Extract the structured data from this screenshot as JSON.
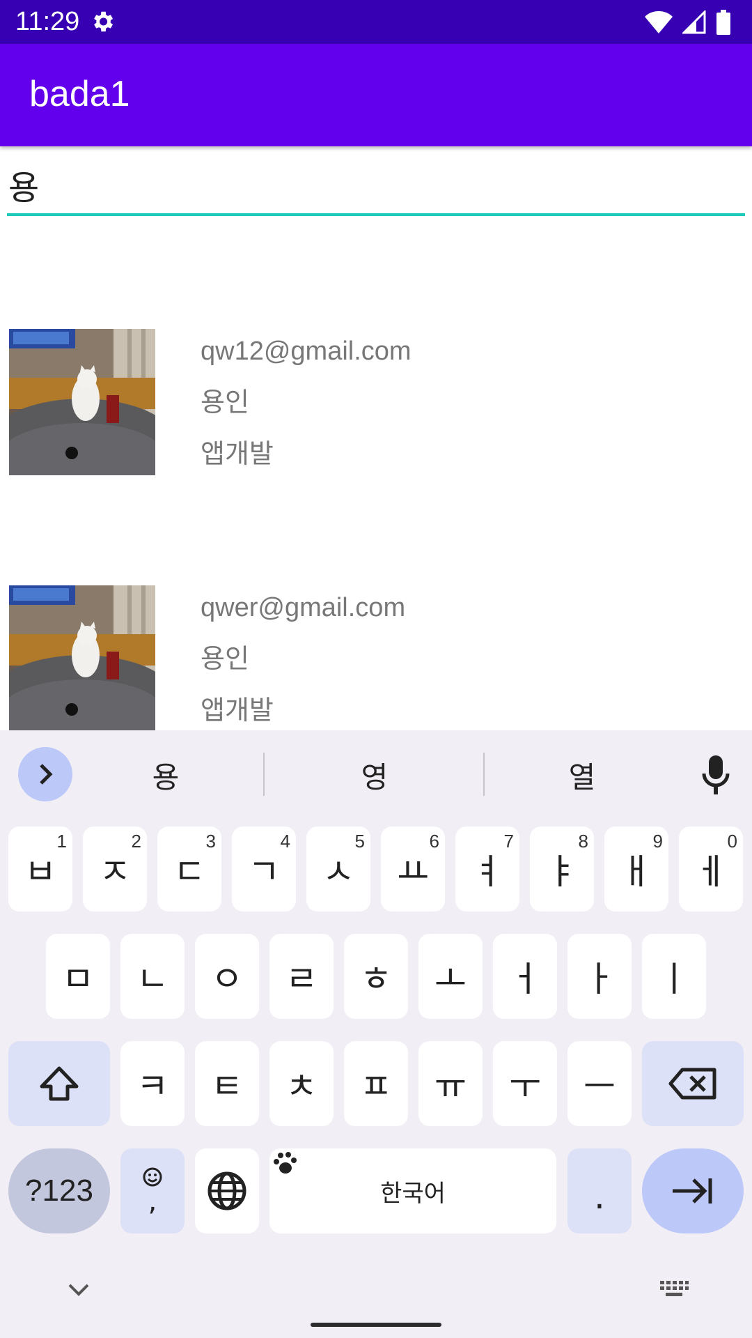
{
  "status_bar": {
    "time": "11:29"
  },
  "app_bar": {
    "title": "bada1"
  },
  "search": {
    "value": "용"
  },
  "results": [
    {
      "email": "qw12@gmail.com",
      "name": "용인",
      "job": "앱개발"
    },
    {
      "email": "qwer@gmail.com",
      "name": "용인",
      "job": "앱개발"
    }
  ],
  "keyboard": {
    "suggestions": [
      "용",
      "영",
      "열"
    ],
    "row1": [
      {
        "label": "ㅂ",
        "num": "1"
      },
      {
        "label": "ㅈ",
        "num": "2"
      },
      {
        "label": "ㄷ",
        "num": "3"
      },
      {
        "label": "ㄱ",
        "num": "4"
      },
      {
        "label": "ㅅ",
        "num": "5"
      },
      {
        "label": "ㅛ",
        "num": "6"
      },
      {
        "label": "ㅕ",
        "num": "7"
      },
      {
        "label": "ㅑ",
        "num": "8"
      },
      {
        "label": "ㅐ",
        "num": "9"
      },
      {
        "label": "ㅔ",
        "num": "0"
      }
    ],
    "row2": [
      "ㅁ",
      "ㄴ",
      "ㅇ",
      "ㄹ",
      "ㅎ",
      "ㅗ",
      "ㅓ",
      "ㅏ",
      "ㅣ"
    ],
    "row3": [
      "ㅋ",
      "ㅌ",
      "ㅊ",
      "ㅍ",
      "ㅠ",
      "ㅜ",
      "ㅡ"
    ],
    "symbols_label": "?123",
    "comma_label": ",",
    "space_label": "한국어",
    "period_label": "."
  },
  "colors": {
    "status_bar": "#3700b3",
    "app_bar": "#6200ee",
    "input_underline": "#1ec9b7",
    "keyboard_bg": "#f2eef5",
    "key_accent": "#dde1f7",
    "enter_key": "#bcc8f8"
  }
}
